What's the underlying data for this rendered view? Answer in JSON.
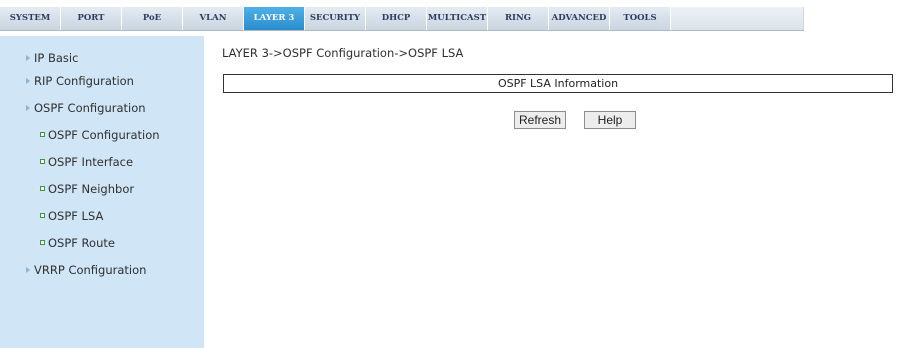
{
  "nav": {
    "tabs": [
      "SYSTEM",
      "PORT",
      "PoE",
      "VLAN",
      "LAYER 3",
      "SECURITY",
      "DHCP",
      "MULTICAST",
      "RING",
      "ADVANCED",
      "TOOLS"
    ],
    "active_tab": "LAYER 3"
  },
  "sidebar": {
    "items": [
      {
        "label": "IP Basic"
      },
      {
        "label": "RIP Configuration"
      },
      {
        "label": "OSPF Configuration"
      }
    ],
    "ospf_children": [
      {
        "label": "OSPF Configuration"
      },
      {
        "label": "OSPF Interface"
      },
      {
        "label": "OSPF Neighbor"
      },
      {
        "label": "OSPF LSA"
      },
      {
        "label": "OSPF Route"
      }
    ],
    "after_items": [
      {
        "label": "VRRP Configuration"
      }
    ]
  },
  "main": {
    "breadcrumb": "LAYER 3->OSPF Configuration->OSPF LSA",
    "section_title": "OSPF LSA Information",
    "refresh_label": "Refresh",
    "help_label": "Help"
  },
  "colors": {
    "active_tab": "#2a8ccc",
    "sidebar_bg": "#d0e5f6"
  }
}
